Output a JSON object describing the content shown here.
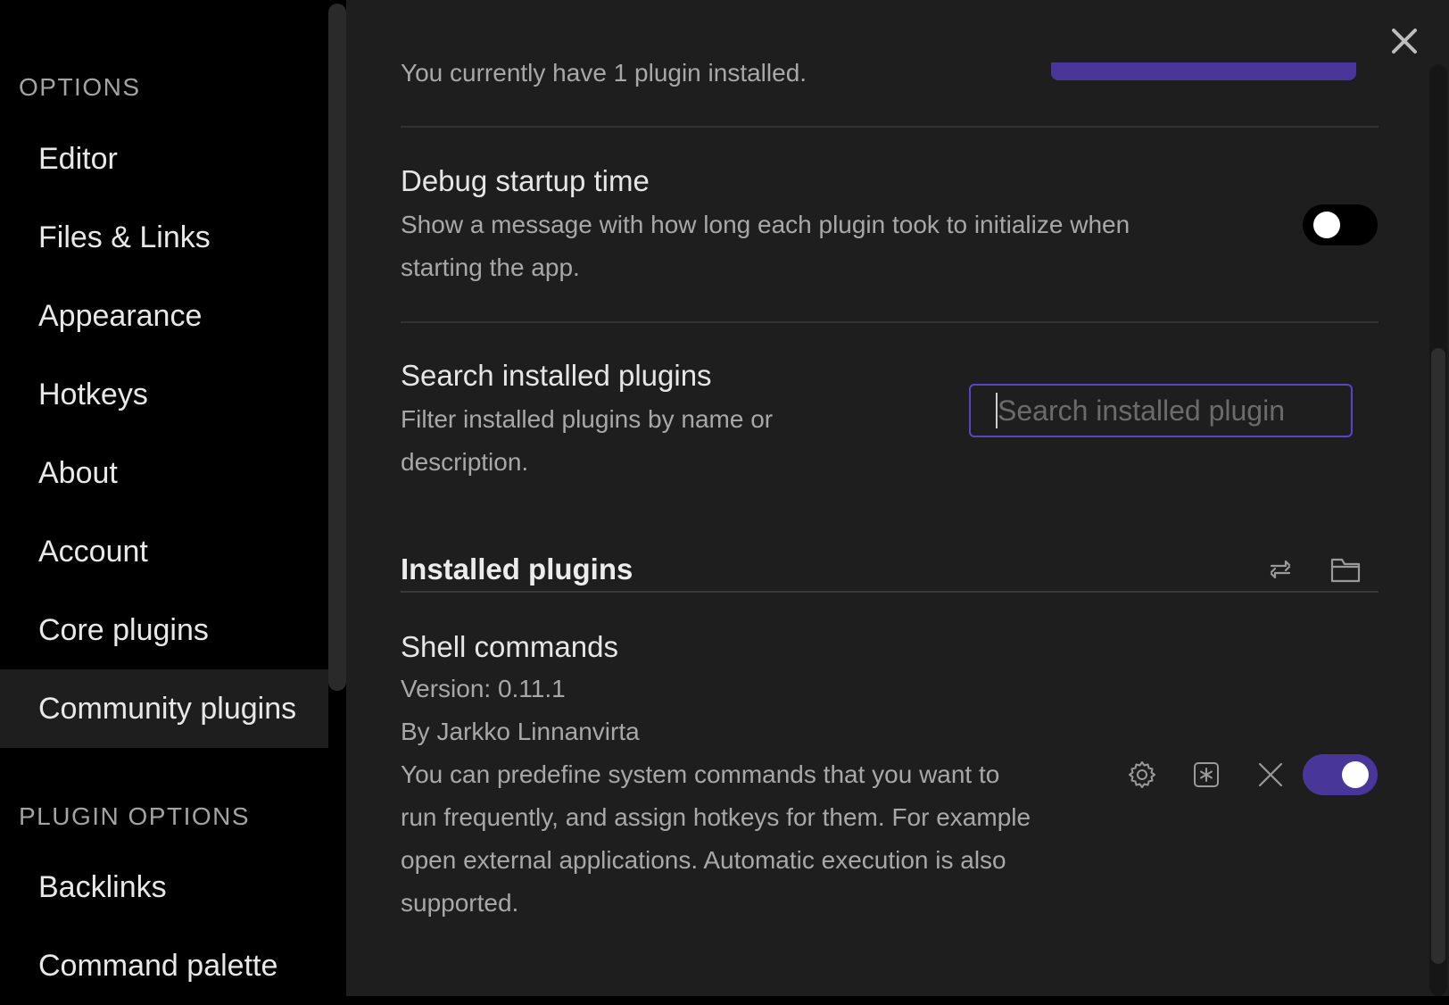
{
  "sidebar": {
    "options_header": "OPTIONS",
    "items": [
      {
        "label": "Editor"
      },
      {
        "label": "Files & Links"
      },
      {
        "label": "Appearance"
      },
      {
        "label": "Hotkeys"
      },
      {
        "label": "About"
      },
      {
        "label": "Account"
      },
      {
        "label": "Core plugins"
      },
      {
        "label": "Community plugins",
        "active": true
      }
    ],
    "plugin_options_header": "PLUGIN OPTIONS",
    "plugin_items": [
      {
        "label": "Backlinks"
      },
      {
        "label": "Command palette"
      }
    ]
  },
  "main": {
    "installed_count_text": "You currently have 1 plugin installed.",
    "debug": {
      "title": "Debug startup time",
      "desc_line1": "Show a message with how long each plugin took to initialize when",
      "desc_line2": "starting the app.",
      "enabled": false
    },
    "search": {
      "title": "Search installed plugins",
      "desc_line1": "Filter installed plugins by name or",
      "desc_line2": "description.",
      "placeholder": "Search installed plugin",
      "value": ""
    },
    "installed_heading": "Installed plugins",
    "icons": {
      "reload": "reload-icon",
      "folder": "folder-icon",
      "settings": "gear-icon",
      "hotkey": "hotkey-icon",
      "uninstall": "close-icon",
      "close_modal": "close-icon"
    },
    "plugin": {
      "name": "Shell commands",
      "version": "Version: 0.11.1",
      "author": "By Jarkko Linnanvirta",
      "desc_line1": "You can predefine system commands that you want to",
      "desc_line2": "run frequently, and assign hotkeys for them. For example",
      "desc_line3": "open external applications. Automatic execution is also",
      "desc_line4": "supported.",
      "enabled": true
    }
  },
  "colors": {
    "accent": "#483699",
    "background": "#1e1e1e",
    "sidebar": "#000000"
  }
}
